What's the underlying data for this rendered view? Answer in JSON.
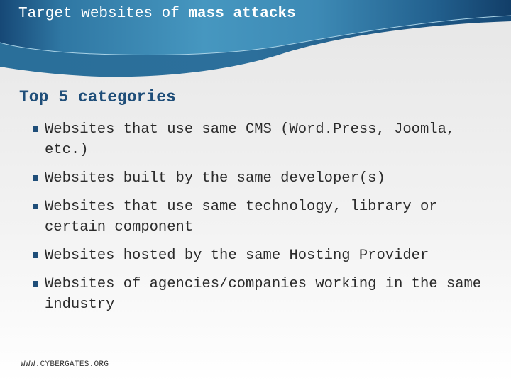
{
  "slide": {
    "title_regular": "Target websites of ",
    "title_bold": "mass attacks",
    "subtitle": "Top 5 categories",
    "bullets": [
      {
        "text": "Websites that use same CMS (Word.Press, Joomla, etc.)"
      },
      {
        "text": "Websites built by the same developer(s)"
      },
      {
        "text": "Websites that use same technology, library or certain component"
      },
      {
        "text": "Websites hosted by the same Hosting Provider"
      },
      {
        "text": "Websites of agencies/companies working in the same industry"
      }
    ],
    "footer": "WWW.CYBERGATES.ORG"
  },
  "colors": {
    "header_dark": "#14406a",
    "header_light": "#4a9cc4",
    "subtitle": "#1f4e79",
    "bullet_marker": "#1f4e79"
  }
}
